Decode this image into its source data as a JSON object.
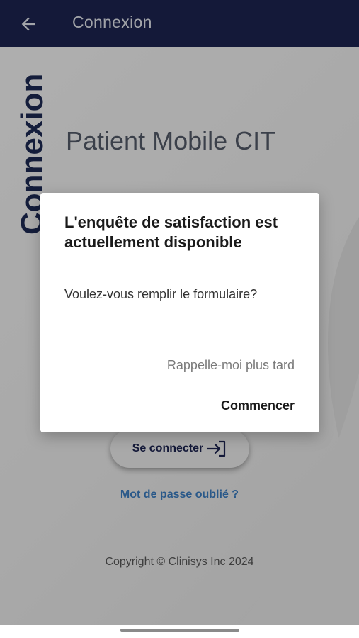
{
  "header": {
    "title": "Connexion",
    "back_icon": "arrow-left-icon"
  },
  "page": {
    "vertical_title": "Connexion",
    "app_name": "Patient Mobile CIT",
    "connect_label": "Se connecter",
    "connect_icon": "login-icon",
    "forgot_password": "Mot de passe oublié ?",
    "copyright": "Copyright © Clinisys Inc 2024"
  },
  "dialog": {
    "title": "L'enquête de satisfaction est actuellement disponible",
    "message": "Voulez-vous remplir le formulaire?",
    "remind_label": "Rappelle-moi plus tard",
    "start_label": "Commencer"
  },
  "colors": {
    "header_bg": "#1d2552",
    "primary_text": "#1d2a55",
    "link": "#3b7fc4"
  }
}
